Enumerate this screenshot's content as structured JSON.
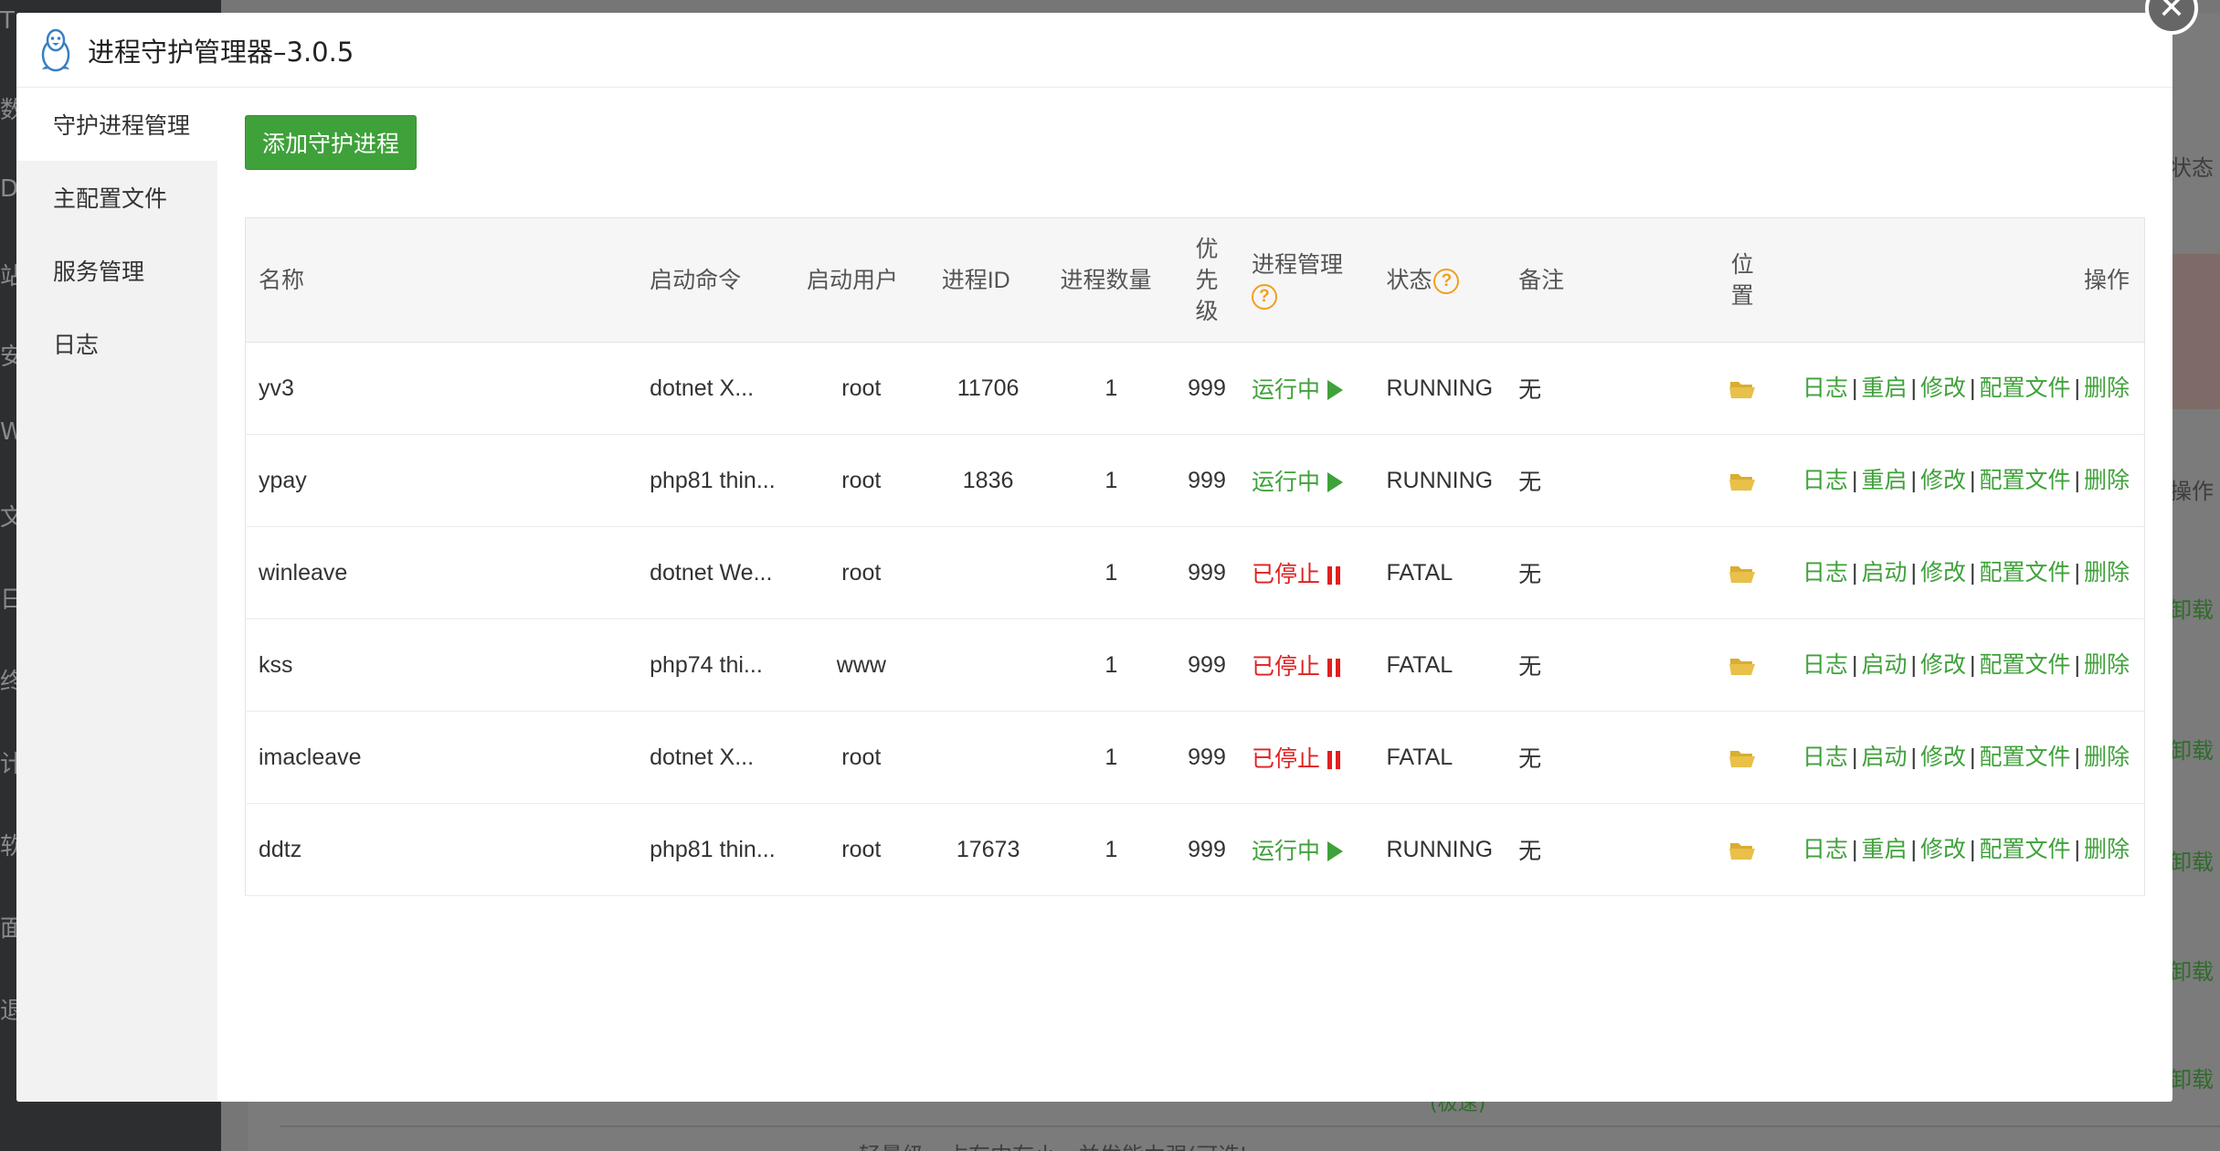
{
  "modal": {
    "title": "进程守护管理器–3.0.5"
  },
  "side_nav": [
    {
      "label": "守护进程管理",
      "active": true
    },
    {
      "label": "主配置文件",
      "active": false
    },
    {
      "label": "服务管理",
      "active": false
    },
    {
      "label": "日志",
      "active": false
    }
  ],
  "toolbar": {
    "add_label": "添加守护进程"
  },
  "table": {
    "headers": {
      "name": "名称",
      "command": "启动命令",
      "user": "启动用户",
      "pid": "进程ID",
      "count": "进程数量",
      "priority": "优先级",
      "manage": "进程管理",
      "status": "状态",
      "remark": "备注",
      "location": "位置",
      "actions": "操作"
    },
    "rows": [
      {
        "name": "yv3",
        "command": "dotnet X...",
        "user": "root",
        "pid": "11706",
        "count": "1",
        "priority": "999",
        "manage": "运行中",
        "state": "running",
        "status": "RUNNING",
        "remark": "无",
        "actions": [
          "日志",
          "重启",
          "修改",
          "配置文件",
          "删除"
        ]
      },
      {
        "name": "ypay",
        "command": "php81 thin...",
        "user": "root",
        "pid": "1836",
        "count": "1",
        "priority": "999",
        "manage": "运行中",
        "state": "running",
        "status": "RUNNING",
        "remark": "无",
        "actions": [
          "日志",
          "重启",
          "修改",
          "配置文件",
          "删除"
        ]
      },
      {
        "name": "winleave",
        "command": "dotnet We...",
        "user": "root",
        "pid": "",
        "count": "1",
        "priority": "999",
        "manage": "已停止",
        "state": "stopped",
        "status": "FATAL",
        "remark": "无",
        "actions": [
          "日志",
          "启动",
          "修改",
          "配置文件",
          "删除"
        ]
      },
      {
        "name": "kss",
        "command": "php74 thi...",
        "user": "www",
        "pid": "",
        "count": "1",
        "priority": "999",
        "manage": "已停止",
        "state": "stopped",
        "status": "FATAL",
        "remark": "无",
        "actions": [
          "日志",
          "启动",
          "修改",
          "配置文件",
          "删除"
        ]
      },
      {
        "name": "imacleave",
        "command": "dotnet X...",
        "user": "root",
        "pid": "",
        "count": "1",
        "priority": "999",
        "manage": "已停止",
        "state": "stopped",
        "status": "FATAL",
        "remark": "无",
        "actions": [
          "日志",
          "启动",
          "修改",
          "配置文件",
          "删除"
        ]
      },
      {
        "name": "ddtz",
        "command": "php81 thin...",
        "user": "root",
        "pid": "17673",
        "count": "1",
        "priority": "999",
        "manage": "运行中",
        "state": "running",
        "status": "RUNNING",
        "remark": "无",
        "actions": [
          "日志",
          "重启",
          "修改",
          "配置文件",
          "删除"
        ]
      }
    ]
  },
  "background": {
    "left_chars": [
      "T",
      "数",
      "Do",
      "站",
      "安",
      "W",
      "文",
      "日",
      "终",
      "计",
      "软",
      "面",
      "退"
    ],
    "right_labels": {
      "status": "状态",
      "actions": "操作"
    },
    "right_links": [
      "卸载",
      "卸载",
      "卸载",
      "卸载",
      "卸载"
    ],
    "bottom_text": "轻量级，占有内存小，并发能力强(可选I...",
    "bottom_green": "(极速)"
  },
  "colors": {
    "accent_green": "#3fa13a",
    "stopped_red": "#e02020",
    "help_orange": "#f0a020",
    "folder_yellow": "#e8c04a"
  },
  "icons": {
    "logo": "linux-penguin-icon",
    "close": "close-icon",
    "help": "help-circle-icon",
    "running": "play-icon",
    "stopped": "pause-icon",
    "location": "folder-icon"
  }
}
